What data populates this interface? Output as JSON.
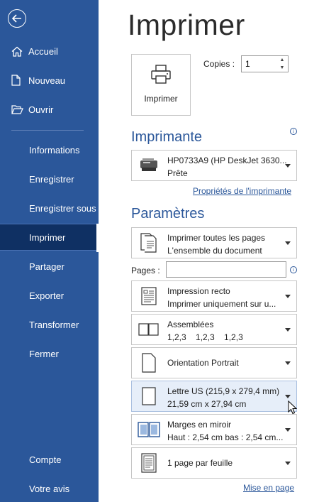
{
  "sidebar": {
    "items": [
      {
        "label": "Accueil",
        "icon": "home-icon"
      },
      {
        "label": "Nouveau",
        "icon": "new-document-icon"
      },
      {
        "label": "Ouvrir",
        "icon": "open-folder-icon"
      },
      {
        "label": "Informations"
      },
      {
        "label": "Enregistrer"
      },
      {
        "label": "Enregistrer sous"
      },
      {
        "label": "Imprimer",
        "active": true
      },
      {
        "label": "Partager"
      },
      {
        "label": "Exporter"
      },
      {
        "label": "Transformer"
      },
      {
        "label": "Fermer"
      },
      {
        "label": "Compte"
      },
      {
        "label": "Votre avis"
      }
    ]
  },
  "main": {
    "title": "Imprimer",
    "print_button_label": "Imprimer",
    "copies_label": "Copies :",
    "copies_value": "1",
    "printer_section": "Imprimante",
    "printer": {
      "name": "HP0733A9 (HP DeskJet 3630...",
      "status": "Prête"
    },
    "printer_properties_link": "Propriétés de l'imprimante",
    "settings_section": "Paramètres",
    "pages_label": "Pages :",
    "pages_value": "",
    "settings": [
      {
        "line1": "Imprimer toutes les pages",
        "line2": "L'ensemble du document",
        "icon": "pages-icon"
      },
      {
        "line1": "Impression recto",
        "line2": "Imprimer uniquement sur u...",
        "icon": "one-sided-icon"
      },
      {
        "line1": "Assemblées",
        "line2": "1,2,3    1,2,3    1,2,3",
        "icon": "collated-icon"
      },
      {
        "line1": "Orientation Portrait",
        "icon": "portrait-icon"
      },
      {
        "line1": "Lettre US (215,9 x 279,4 mm)",
        "line2": "21,59 cm x 27,94 cm",
        "icon": "paper-size-icon"
      },
      {
        "line1": "Marges en miroir",
        "line2": "Haut : 2,54 cm bas : 2,54 cm...",
        "icon": "margins-icon"
      },
      {
        "line1": "1 page par feuille",
        "icon": "pages-per-sheet-icon"
      }
    ],
    "page_setup_link": "Mise en page"
  }
}
